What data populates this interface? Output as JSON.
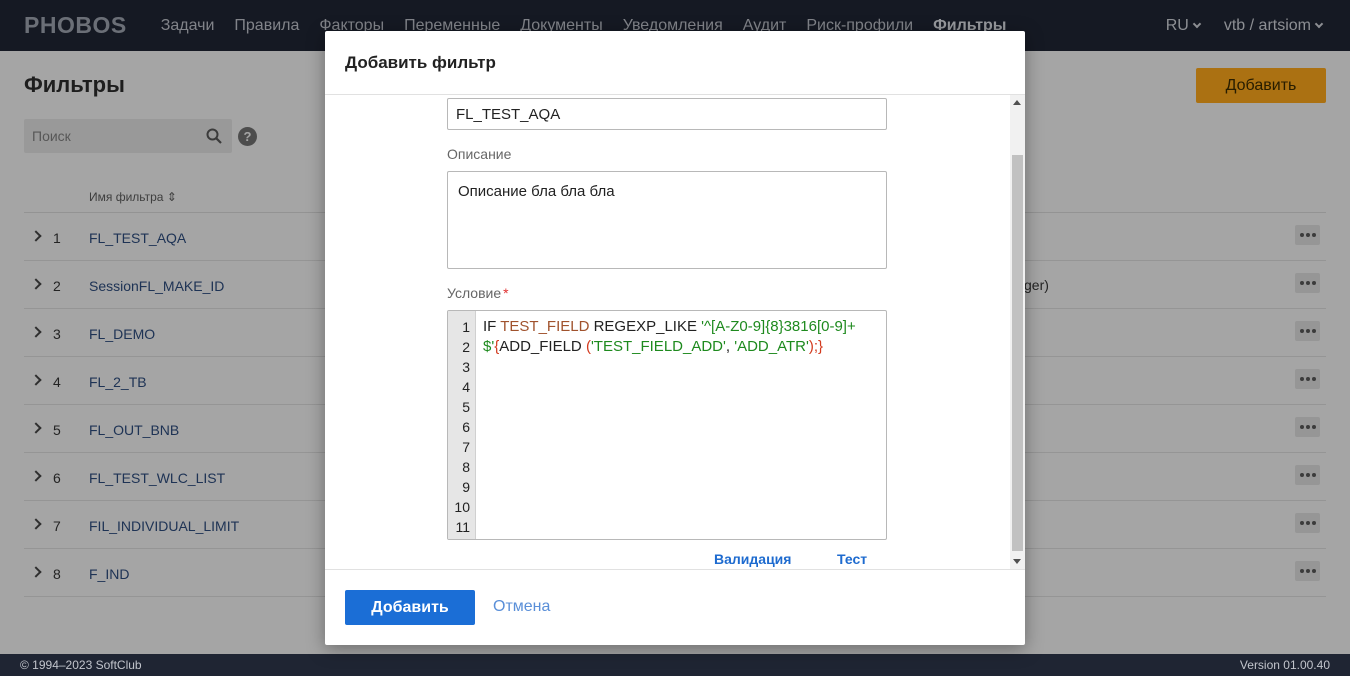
{
  "app": {
    "logo": "PHOBOS"
  },
  "nav": {
    "items": [
      "Задачи",
      "Правила",
      "Факторы",
      "Переменные",
      "Документы",
      "Уведомления",
      "Аудит",
      "Риск-профили",
      "Фильтры"
    ],
    "active": "Фильтры"
  },
  "user": {
    "lang": "RU",
    "account": "vtb / artsiom"
  },
  "page": {
    "title": "Фильтры",
    "add_label": "Добавить",
    "search_placeholder": "Поиск",
    "help": "?"
  },
  "table": {
    "column_name": "Имя фильтра",
    "rows": [
      {
        "num": "1",
        "name": "FL_TEST_AQA"
      },
      {
        "num": "2",
        "name": "SessionFL_MAKE_ID",
        "side": "ger)"
      },
      {
        "num": "3",
        "name": "FL_DEMO"
      },
      {
        "num": "4",
        "name": "FL_2_TB"
      },
      {
        "num": "5",
        "name": "FL_OUT_BNB"
      },
      {
        "num": "6",
        "name": "FL_TEST_WLC_LIST"
      },
      {
        "num": "7",
        "name": "FIL_INDIVIDUAL_LIMIT"
      },
      {
        "num": "8",
        "name": "F_IND"
      }
    ]
  },
  "footer": {
    "copyright": "© 1994–2023 SoftClub",
    "version": "Version 01.00.40"
  },
  "modal": {
    "title": "Добавить фильтр",
    "name_value": "FL_TEST_AQA",
    "description_label": "Описание",
    "description_value": "Описание бла бла бла",
    "condition_label": "Условие",
    "required_mark": "*",
    "line_numbers": [
      "1",
      "2",
      "3",
      "4",
      "5",
      "6",
      "7",
      "8",
      "9",
      "10",
      "11"
    ],
    "code": {
      "kw_if": "IF ",
      "field": "TEST_FIELD",
      "kw_regexp": " REGEXP_LIKE ",
      "pattern": "'^[A-Z0-9]{8}3816[0-9]+$'",
      "brace_open": "{",
      "func": "ADD_FIELD ",
      "paren_open": "(",
      "arg1": "'TEST_FIELD_ADD'",
      "comma": ", ",
      "arg2": "'ADD_ATR'",
      "close": ");}"
    },
    "validate_link": "Валидация",
    "test_link": "Тест",
    "submit_label": "Добавить",
    "cancel_label": "Отмена"
  }
}
